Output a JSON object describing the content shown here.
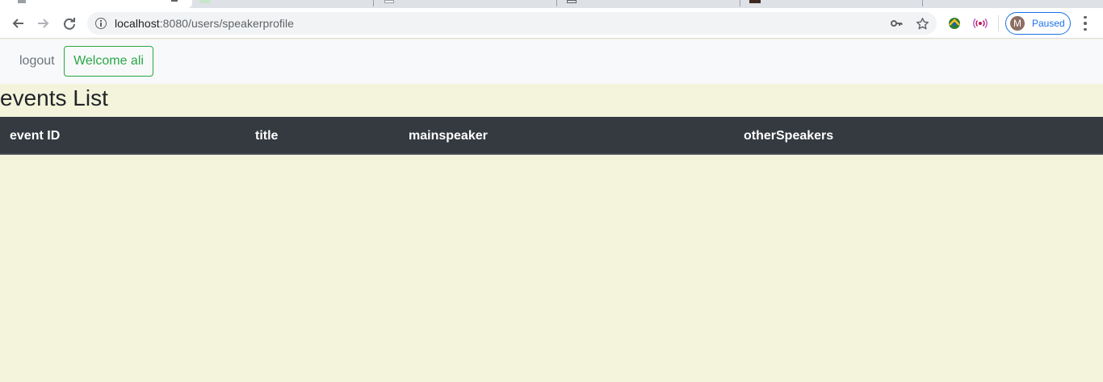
{
  "browser": {
    "url_host": "localhost",
    "url_port": ":8080",
    "url_path": "/users/speakerprofile",
    "profile_initial": "M",
    "profile_status": "Paused",
    "icons": [
      "back-arrow-icon",
      "forward-arrow-icon",
      "reload-icon",
      "info-icon",
      "key-icon",
      "star-icon",
      "extension-globe-icon",
      "extension-broadcast-icon",
      "menu-dots-icon"
    ]
  },
  "navbar": {
    "logout_label": "logout",
    "welcome_label": "Welcome ali"
  },
  "main": {
    "title": "events List",
    "table": {
      "columns": [
        "event ID",
        "title",
        "mainspeaker",
        "otherSpeakers"
      ],
      "rows": []
    }
  },
  "colors": {
    "page_bg": "#f4f4dc",
    "navbar_bg": "#f8f9fa",
    "thead_bg": "#343a40",
    "accent_green": "#28a745",
    "profile_blue": "#1a73e8"
  }
}
